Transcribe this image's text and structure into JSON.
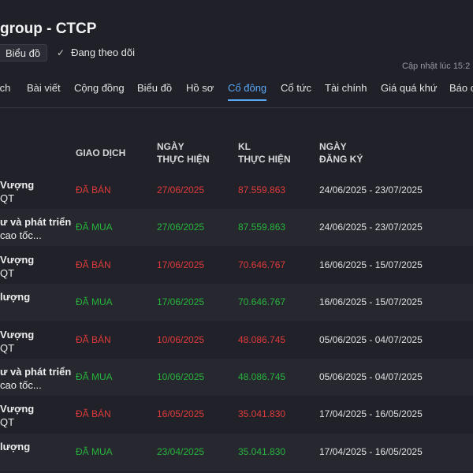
{
  "header": {
    "title": "group - CTCP",
    "chart_button": "Biểu đồ",
    "follow_check": "✓",
    "follow_label": "Đang theo dõi",
    "updated": "Cập nhật lúc  15:2"
  },
  "tabs": [
    {
      "label": "ích"
    },
    {
      "label": "Bài viết"
    },
    {
      "label": "Cộng đồng"
    },
    {
      "label": "Biểu đồ"
    },
    {
      "label": "Hồ sơ"
    },
    {
      "label": "Cổ đông"
    },
    {
      "label": "Cổ tức"
    },
    {
      "label": "Tài chính"
    },
    {
      "label": "Giá quá khứ"
    },
    {
      "label": "Báo c"
    }
  ],
  "active_tab": "Cổ đông",
  "table": {
    "headers": {
      "transaction": "GIAO DỊCH",
      "exec_date_1": "NGÀY",
      "exec_date_2": "THỰC HIỆN",
      "exec_vol_1": "KL",
      "exec_vol_2": "THỰC HIỆN",
      "reg_date_1": "NGÀY",
      "reg_date_2": "ĐĂNG KÝ"
    },
    "rows": [
      {
        "name1": "Vượng",
        "name2": "QT",
        "type": "ĐÃ BÁN",
        "kind": "sell",
        "date": "27/06/2025",
        "volume": "87.559.863",
        "reg": "24/06/2025 - 23/07/2025"
      },
      {
        "name1": "ư và phát triển",
        "name2": "cao tốc...",
        "type": "ĐÃ MUA",
        "kind": "buy",
        "date": "27/06/2025",
        "volume": "87.559.863",
        "reg": "24/06/2025 - 23/07/2025"
      },
      {
        "name1": "Vượng",
        "name2": "QT",
        "type": "ĐÃ BÁN",
        "kind": "sell",
        "date": "17/06/2025",
        "volume": "70.646.767",
        "reg": "16/06/2025 - 15/07/2025"
      },
      {
        "name1": "lượng",
        "name2": "",
        "type": "ĐÃ MUA",
        "kind": "buy",
        "date": "17/06/2025",
        "volume": "70.646.767",
        "reg": "16/06/2025 - 15/07/2025"
      },
      {
        "name1": "Vượng",
        "name2": "QT",
        "type": "ĐÃ BÁN",
        "kind": "sell",
        "date": "10/06/2025",
        "volume": "48.086.745",
        "reg": "05/06/2025 - 04/07/2025"
      },
      {
        "name1": "ư và phát triển",
        "name2": "cao tốc...",
        "type": "ĐÃ MUA",
        "kind": "buy",
        "date": "10/06/2025",
        "volume": "48.086.745",
        "reg": "05/06/2025 - 04/07/2025"
      },
      {
        "name1": "Vượng",
        "name2": "QT",
        "type": "ĐÃ BÁN",
        "kind": "sell",
        "date": "16/05/2025",
        "volume": "35.041.830",
        "reg": "17/04/2025 - 16/05/2025"
      },
      {
        "name1": "lượng",
        "name2": "",
        "type": "ĐÃ MUA",
        "kind": "buy",
        "date": "23/04/2025",
        "volume": "35.041.830",
        "reg": "17/04/2025 - 16/05/2025"
      }
    ]
  },
  "colors": {
    "accent": "#5ba8f5",
    "sell": "#e03b3b",
    "buy": "#27b53c",
    "background": "#202129"
  }
}
